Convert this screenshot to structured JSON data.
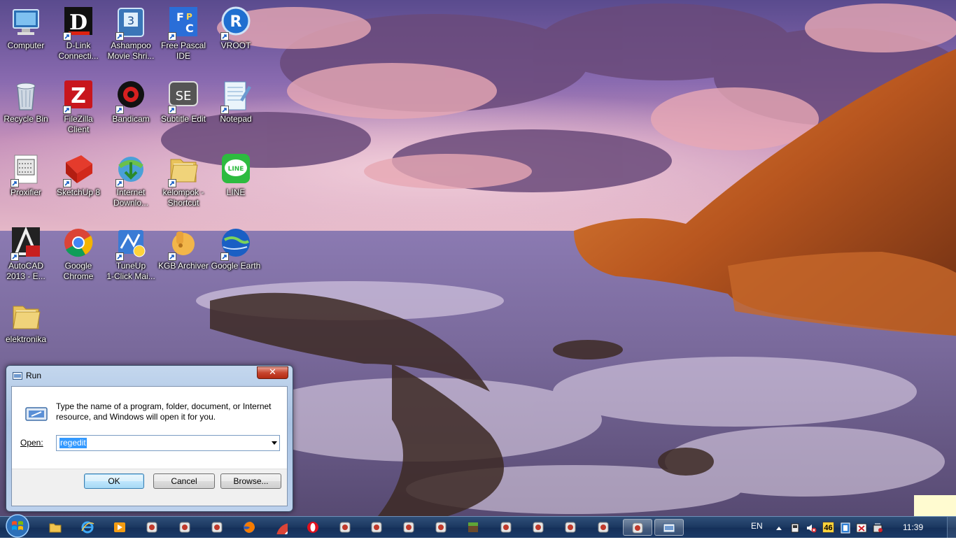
{
  "desktop": {
    "icons": [
      {
        "label": "Computer",
        "icon": "computer-icon",
        "shortcut": false
      },
      {
        "label": "D-Link\nConnecti...",
        "icon": "dlink-icon",
        "shortcut": true
      },
      {
        "label": "Ashampoo\nMovie Shri...",
        "icon": "ashampoo-icon",
        "shortcut": true
      },
      {
        "label": "Free Pascal\nIDE",
        "icon": "freepascal-icon",
        "shortcut": true
      },
      {
        "label": "VROOT",
        "icon": "vroot-icon",
        "shortcut": true
      },
      {
        "label": "Recycle Bin",
        "icon": "recycle-bin-icon",
        "shortcut": false
      },
      {
        "label": "FileZilla\nClient",
        "icon": "filezilla-icon",
        "shortcut": true
      },
      {
        "label": "Bandicam",
        "icon": "bandicam-icon",
        "shortcut": true
      },
      {
        "label": "Subtitle Edit",
        "icon": "subtitle-edit-icon",
        "shortcut": true
      },
      {
        "label": "Notepad",
        "icon": "notepad-icon",
        "shortcut": true
      },
      {
        "label": "Proxifier",
        "icon": "proxifier-icon",
        "shortcut": true
      },
      {
        "label": "SketchUp 8",
        "icon": "sketchup-icon",
        "shortcut": true
      },
      {
        "label": "Internet\nDownlo...",
        "icon": "idm-icon",
        "shortcut": true
      },
      {
        "label": "kelompok -\nShortcut",
        "icon": "folder-icon",
        "shortcut": true
      },
      {
        "label": "LINE",
        "icon": "line-icon",
        "shortcut": false
      },
      {
        "label": "AutoCAD\n2013 - E...",
        "icon": "autocad-icon",
        "shortcut": true
      },
      {
        "label": "Google\nChrome",
        "icon": "chrome-icon",
        "shortcut": false
      },
      {
        "label": "TuneUp\n1-Click Mai...",
        "icon": "tuneup-icon",
        "shortcut": true
      },
      {
        "label": "KGB Archiver",
        "icon": "kgb-archiver-icon",
        "shortcut": true
      },
      {
        "label": "Google Earth",
        "icon": "google-earth-icon",
        "shortcut": true
      },
      {
        "label": "elektronika",
        "icon": "folder-icon",
        "shortcut": false
      }
    ]
  },
  "run_dialog": {
    "title": "Run",
    "close_label": "✕",
    "description": "Type the name of a program, folder, document, or Internet resource, and Windows will open it for you.",
    "open_label": "Open:",
    "open_value": "regedit",
    "ok_label": "OK",
    "cancel_label": "Cancel",
    "browse_label": "Browse..."
  },
  "taskbar": {
    "pinned": [
      "windows-explorer-icon",
      "internet-explorer-icon",
      "media-player-icon",
      "app-icon",
      "app-icon",
      "app-icon",
      "firefox-icon",
      "chrome-icon",
      "opera-icon",
      "app-icon",
      "app-icon",
      "app-icon",
      "app-icon",
      "minecraft-icon",
      "app-icon",
      "app-icon",
      "app-icon",
      "app-icon",
      "app-icon",
      "run-icon"
    ],
    "tray": {
      "language": "EN",
      "badge": "46",
      "clock": "11:39"
    }
  },
  "colors": {
    "taskbar": "#1d3a63",
    "dialog_frame": "#a9c3e3",
    "selection": "#3399ff",
    "close_button": "#c7452f"
  }
}
